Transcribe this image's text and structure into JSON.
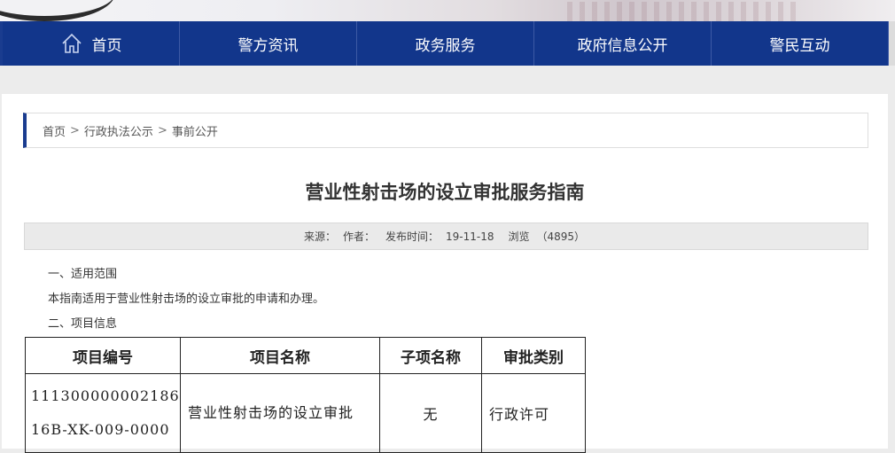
{
  "nav": {
    "items": [
      {
        "label": "首页",
        "icon": "home-icon"
      },
      {
        "label": "警方资讯"
      },
      {
        "label": "政务服务"
      },
      {
        "label": "政府信息公开"
      },
      {
        "label": "警民互动"
      }
    ]
  },
  "breadcrumb": {
    "items": [
      "首页",
      "行政执法公示",
      "事前公开"
    ],
    "separator": ">"
  },
  "article": {
    "title": "营业性射击场的设立审批服务指南",
    "meta": {
      "source_label": "来源：",
      "author_label": "作者：",
      "date_label": "发布时间：",
      "date_value": "19-11-18",
      "views_label": "浏览",
      "views_value": "（4895）"
    },
    "sections": [
      "一、适用范围",
      "本指南适用于营业性射击场的设立审批的申请和办理。",
      "二、项目信息"
    ],
    "table": {
      "headers": [
        "项目编号",
        "项目名称",
        "子项名称",
        "审批类别"
      ],
      "row": {
        "code_line1": "111300000002186",
        "code_line2": "16B-XK-009-0000",
        "name": "营业性射击场的设立审批",
        "sub": "无",
        "category": "行政许可"
      }
    }
  },
  "colors": {
    "nav_bg": "#12368b",
    "accent": "#1a3c8f"
  }
}
